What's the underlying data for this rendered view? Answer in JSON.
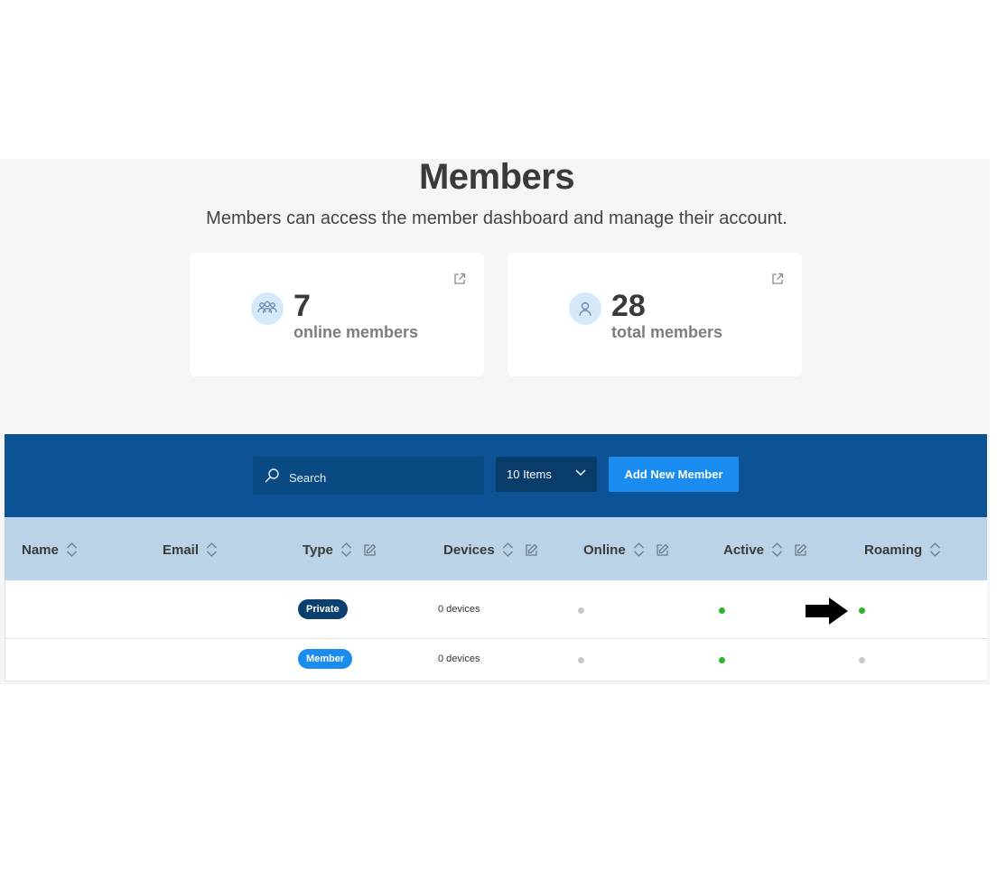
{
  "header": {
    "title": "Members",
    "subtitle": "Members can access the member dashboard and manage their account."
  },
  "stats": [
    {
      "value": "7",
      "label": "online members",
      "icon": "group-icon"
    },
    {
      "value": "28",
      "label": "total members",
      "icon": "user-icon"
    }
  ],
  "toolbar": {
    "search_placeholder": "Search",
    "items_select": "10 Items",
    "add_button": "Add New Member"
  },
  "table": {
    "columns": [
      {
        "label": "Name",
        "sortable": true,
        "editable": false
      },
      {
        "label": "Email",
        "sortable": true,
        "editable": false
      },
      {
        "label": "Type",
        "sortable": true,
        "editable": true
      },
      {
        "label": "Devices",
        "sortable": true,
        "editable": true
      },
      {
        "label": "Online",
        "sortable": true,
        "editable": true
      },
      {
        "label": "Active",
        "sortable": true,
        "editable": true
      },
      {
        "label": "Roaming",
        "sortable": true,
        "editable": false
      }
    ],
    "rows": [
      {
        "name": "",
        "email": "",
        "type": "Private",
        "devices": "0 devices",
        "online": "offline",
        "active": "on",
        "roaming": "on"
      },
      {
        "name": "",
        "email": "",
        "type": "Member",
        "devices": "0 devices",
        "online": "offline",
        "active": "on",
        "roaming": "off"
      }
    ]
  },
  "colors": {
    "toolbar_bg": "#0b5394",
    "header_bg": "#bad3e8",
    "accent": "#1a8cf0",
    "badge_private": "#0b3f6e",
    "badge_member": "#1a8cf0",
    "status_on": "#2db52d",
    "status_off": "#c8c8c8"
  },
  "annotation": {
    "icon": "right-arrow-icon"
  }
}
